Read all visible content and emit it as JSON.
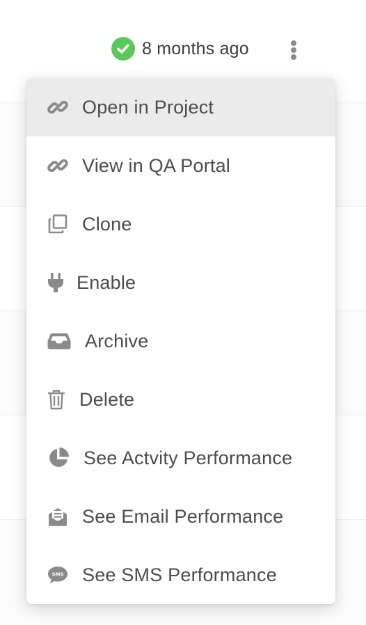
{
  "status": {
    "text": "8 months ago",
    "icon": "check-circle-icon",
    "color": "#5ac85a"
  },
  "menu_button": {
    "icon": "kebab-menu-icon"
  },
  "menu": {
    "items": [
      {
        "label": "Open in Project",
        "icon": "link-icon",
        "active": true
      },
      {
        "label": "View in QA Portal",
        "icon": "link-icon",
        "active": false
      },
      {
        "label": "Clone",
        "icon": "copy-icon",
        "active": false
      },
      {
        "label": "Enable",
        "icon": "plug-icon",
        "active": false
      },
      {
        "label": "Archive",
        "icon": "inbox-icon",
        "active": false
      },
      {
        "label": "Delete",
        "icon": "trash-icon",
        "active": false
      },
      {
        "label": "See Actvity Performance",
        "icon": "pie-chart-icon",
        "active": false
      },
      {
        "label": "See Email Performance",
        "icon": "envelope-open-icon",
        "active": false
      },
      {
        "label": "See SMS Performance",
        "icon": "sms-icon",
        "active": false
      }
    ]
  },
  "colors": {
    "icon": "#8a8a8a",
    "text": "#4c4c4c",
    "active_bg": "#ebebeb"
  }
}
